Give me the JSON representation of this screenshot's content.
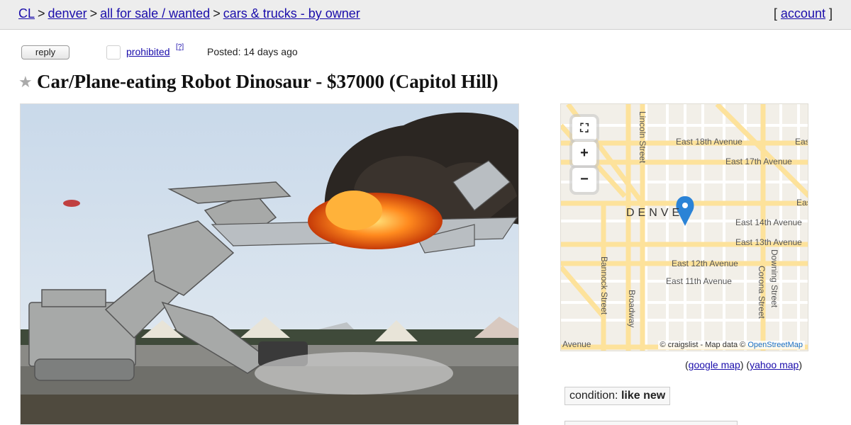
{
  "breadcrumb": {
    "home": "CL",
    "city": "denver",
    "section": "all for sale / wanted",
    "category": "cars & trucks - by owner",
    "sep": ">"
  },
  "account": {
    "open": "[",
    "label": "account",
    "close": "]"
  },
  "actions": {
    "reply": "reply",
    "prohibited": "prohibited",
    "help": "[?]",
    "posted_label": "Posted:",
    "posted_value": "14 days ago"
  },
  "posting": {
    "title": "Car/Plane-eating Robot Dinosaur - $37000 (Capitol Hill)",
    "star_icon": "star-icon"
  },
  "map": {
    "city_label": "DENVE",
    "streets": {
      "e18": "East 18th Avenue",
      "e18b": "Eas",
      "e17": "East 17th Avenue",
      "e14b": "Eas",
      "e14": "East 14th Avenue",
      "e13": "East 13th Avenue",
      "e12": "East 12th Avenue",
      "e11": "East 11th Avenue",
      "lincoln": "Lincoln Street",
      "bannock": "Bannock Street",
      "broadway": "Broadway",
      "downing": "Downing Street",
      "corona": "Corona Street",
      "avenue": "Avenue"
    },
    "attribution": "© craigslist - Map data ©",
    "attribution_link": "OpenStreetMap",
    "controls": {
      "fullscreen": "⛶",
      "zoom_in": "+",
      "zoom_out": "−"
    }
  },
  "map_links": {
    "google": "google map",
    "yahoo": "yahoo map"
  },
  "attributes": {
    "condition_label": "condition:",
    "condition_value": "like new"
  },
  "colors": {
    "link": "#1a0dab",
    "topbar": "#ededed",
    "map_road": "#fde29b",
    "pin": "#2b83d6"
  }
}
